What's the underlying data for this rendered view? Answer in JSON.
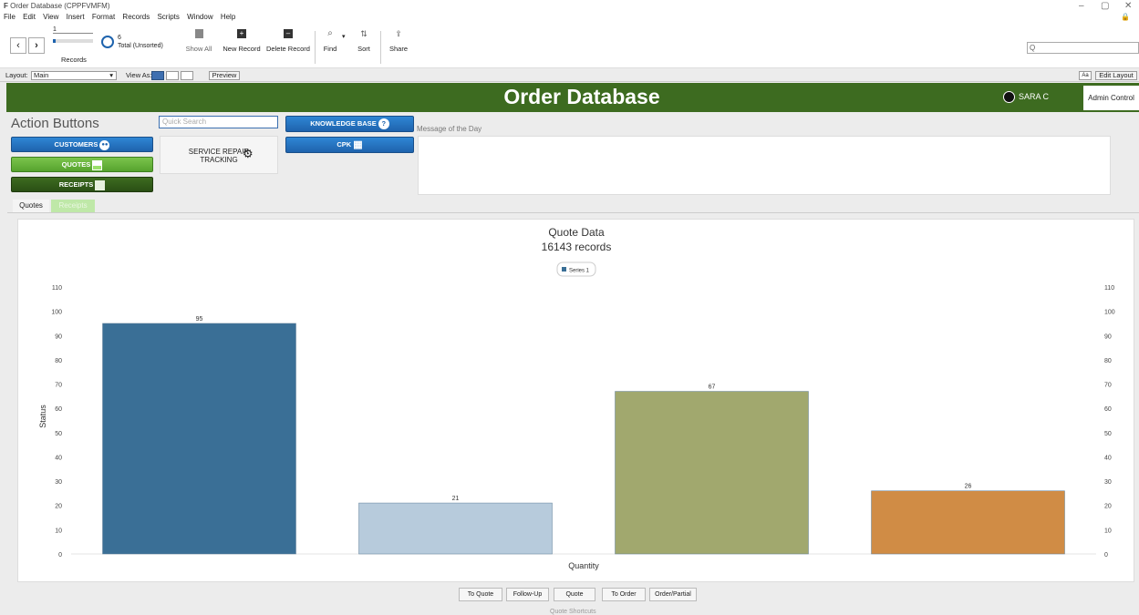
{
  "window": {
    "title": "Order Database (CPPFVMFM)",
    "controls": [
      "–",
      "▢",
      "✕"
    ]
  },
  "menu": [
    "File",
    "Edit",
    "View",
    "Insert",
    "Format",
    "Records",
    "Scripts",
    "Window",
    "Help"
  ],
  "toolbar": {
    "record_current": "1",
    "records_label": "Records",
    "total_count": "6",
    "total_label": "Total (Unsorted)",
    "show_all": "Show All",
    "new_record": "New Record",
    "delete_record": "Delete Record",
    "find": "Find",
    "sort": "Sort",
    "share": "Share",
    "search_glyph": "Q"
  },
  "layoutbar": {
    "layout_label": "Layout:",
    "layout_value": "Main",
    "view_as": "View As:",
    "preview": "Preview",
    "aa": "Aa",
    "edit_layout": "Edit Layout"
  },
  "header": {
    "title": "Order Database",
    "user": "SARA C",
    "admin": "Admin Control"
  },
  "actions": {
    "heading": "Action Buttons",
    "quick_search_placeholder": "Quick Search",
    "customers": "CUSTOMERS",
    "quotes": "QUOTES",
    "receipts": "RECEIPTS",
    "service_repair": "SERVICE REPAIR",
    "tracking": "TRACKING",
    "knowledge_base": "KNOWLEDGE BASE",
    "cpk": "CPK",
    "motd_label": "Message of the Day"
  },
  "tabs": [
    "Quotes",
    "Receipts"
  ],
  "chart_data": {
    "type": "bar",
    "title": "Quote Data",
    "subtitle": "16143 records",
    "xlabel": "Quantity",
    "ylabel": "Status",
    "ylim": [
      0,
      110
    ],
    "yticks": [
      0,
      10,
      20,
      30,
      40,
      50,
      60,
      70,
      80,
      90,
      100,
      110
    ],
    "legend": "top-center",
    "series": [
      {
        "name": "Series 1",
        "values": [
          95,
          21,
          67,
          26
        ]
      }
    ],
    "bar_colors": [
      "#3a6f96",
      "#b7cbdc",
      "#a1a86e",
      "#d08c45"
    ],
    "grid": false
  },
  "shortcuts": [
    "To Quote",
    "Follow-Up",
    "Quote",
    "To Order",
    "Order/Partial"
  ],
  "shortcuts_label": "Quote Shortcuts"
}
